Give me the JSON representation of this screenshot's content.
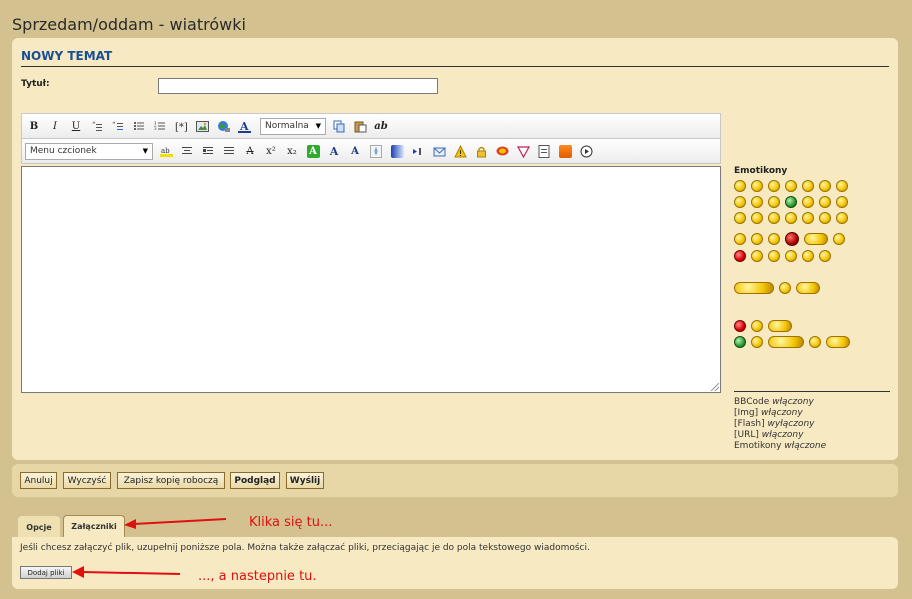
{
  "page": {
    "title": "Sprzedam/oddam - wiatrówki"
  },
  "panel": {
    "heading": "NOWY TEMAT"
  },
  "form": {
    "title_label": "Tytuł:",
    "title_value": ""
  },
  "toolbar": {
    "row1": {
      "bold": "B",
      "italic": "I",
      "underline": "U",
      "font_size": "Normalna",
      "text_style_label": "ab"
    },
    "row2": {
      "font_select": "Menu czcionek",
      "strike": "A",
      "superscript": "x²",
      "subscript": "x₂",
      "font_a1": "A",
      "font_a2": "A",
      "font_a3": "A"
    }
  },
  "smilies": {
    "title": "Emotikony"
  },
  "status": {
    "bbcode_label": "BBCode",
    "bbcode_value": "włączony",
    "img_label": "[Img]",
    "img_value": "włączony",
    "flash_label": "[Flash]",
    "flash_value": "wyłączony",
    "url_label": "[URL]",
    "url_value": "włączony",
    "emoticons_label": "Emotikony",
    "emoticons_value": "włączone"
  },
  "buttons": {
    "cancel": "Anuluj",
    "clear": "Wyczyść",
    "save_draft": "Zapisz kopię roboczą",
    "preview": "Podgląd",
    "submit": "Wyślij"
  },
  "tabs": {
    "options": "Opcje",
    "attachments": "Załączniki"
  },
  "attachments": {
    "info": "Jeśli chcesz załączyć plik, uzupełnij poniższe pola. Można także załączać pliki, przeciągając je do pola tekstowego wiadomości.",
    "add_files": "Dodaj pliki"
  },
  "annotations": {
    "first": "Klika się tu...",
    "second": "..., a nastepnie tu."
  },
  "colors": {
    "heading_blue": "#1a4f96",
    "annotation_red": "#e01010",
    "panel_bg": "#f7e9c2",
    "page_bg": "#d4c190"
  }
}
